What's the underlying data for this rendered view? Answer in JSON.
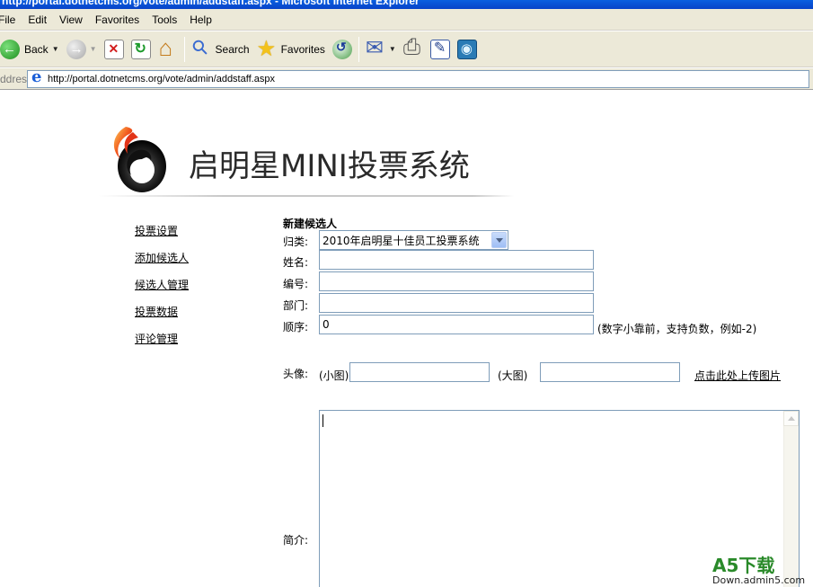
{
  "window": {
    "title": "http://portal.dotnetcms.org/vote/admin/addstaff.aspx - Microsoft Internet Explorer"
  },
  "menu": [
    "File",
    "Edit",
    "View",
    "Favorites",
    "Tools",
    "Help"
  ],
  "toolbar": {
    "back_label": "Back",
    "search_label": "Search",
    "favorites_label": "Favorites"
  },
  "address": {
    "label": "Address",
    "url": "http://portal.dotnetcms.org/vote/admin/addstaff.aspx"
  },
  "logo": {
    "text": "启明星MINI投票系统"
  },
  "nav": [
    "投票设置",
    "添加候选人",
    "候选人管理",
    "投票数据",
    "评论管理"
  ],
  "form": {
    "title": "新建候选人",
    "category_label": "归类:",
    "category_value": "2010年启明星十佳员工投票系统",
    "name_label": "姓名:",
    "name_value": "",
    "number_label": "编号:",
    "number_value": "",
    "dept_label": "部门:",
    "dept_value": "",
    "order_label": "顺序:",
    "order_value": "0",
    "order_hint": "(数字小靠前，支持负数，例如-2)",
    "avatar_label": "头像:",
    "small_label": "(小图)",
    "small_value": "",
    "large_label": "(大图)",
    "large_value": "",
    "upload_link": "点击此处上传图片",
    "intro_label": "简介:",
    "intro_value": ""
  },
  "watermark": {
    "main": "A5下载",
    "sub": "Down.admin5.com"
  },
  "colors": {
    "titlebar": "#0a5fe0",
    "chrome": "#ece9d8",
    "input_border": "#7f9db9",
    "watermark_green": "#2a8a2a"
  }
}
